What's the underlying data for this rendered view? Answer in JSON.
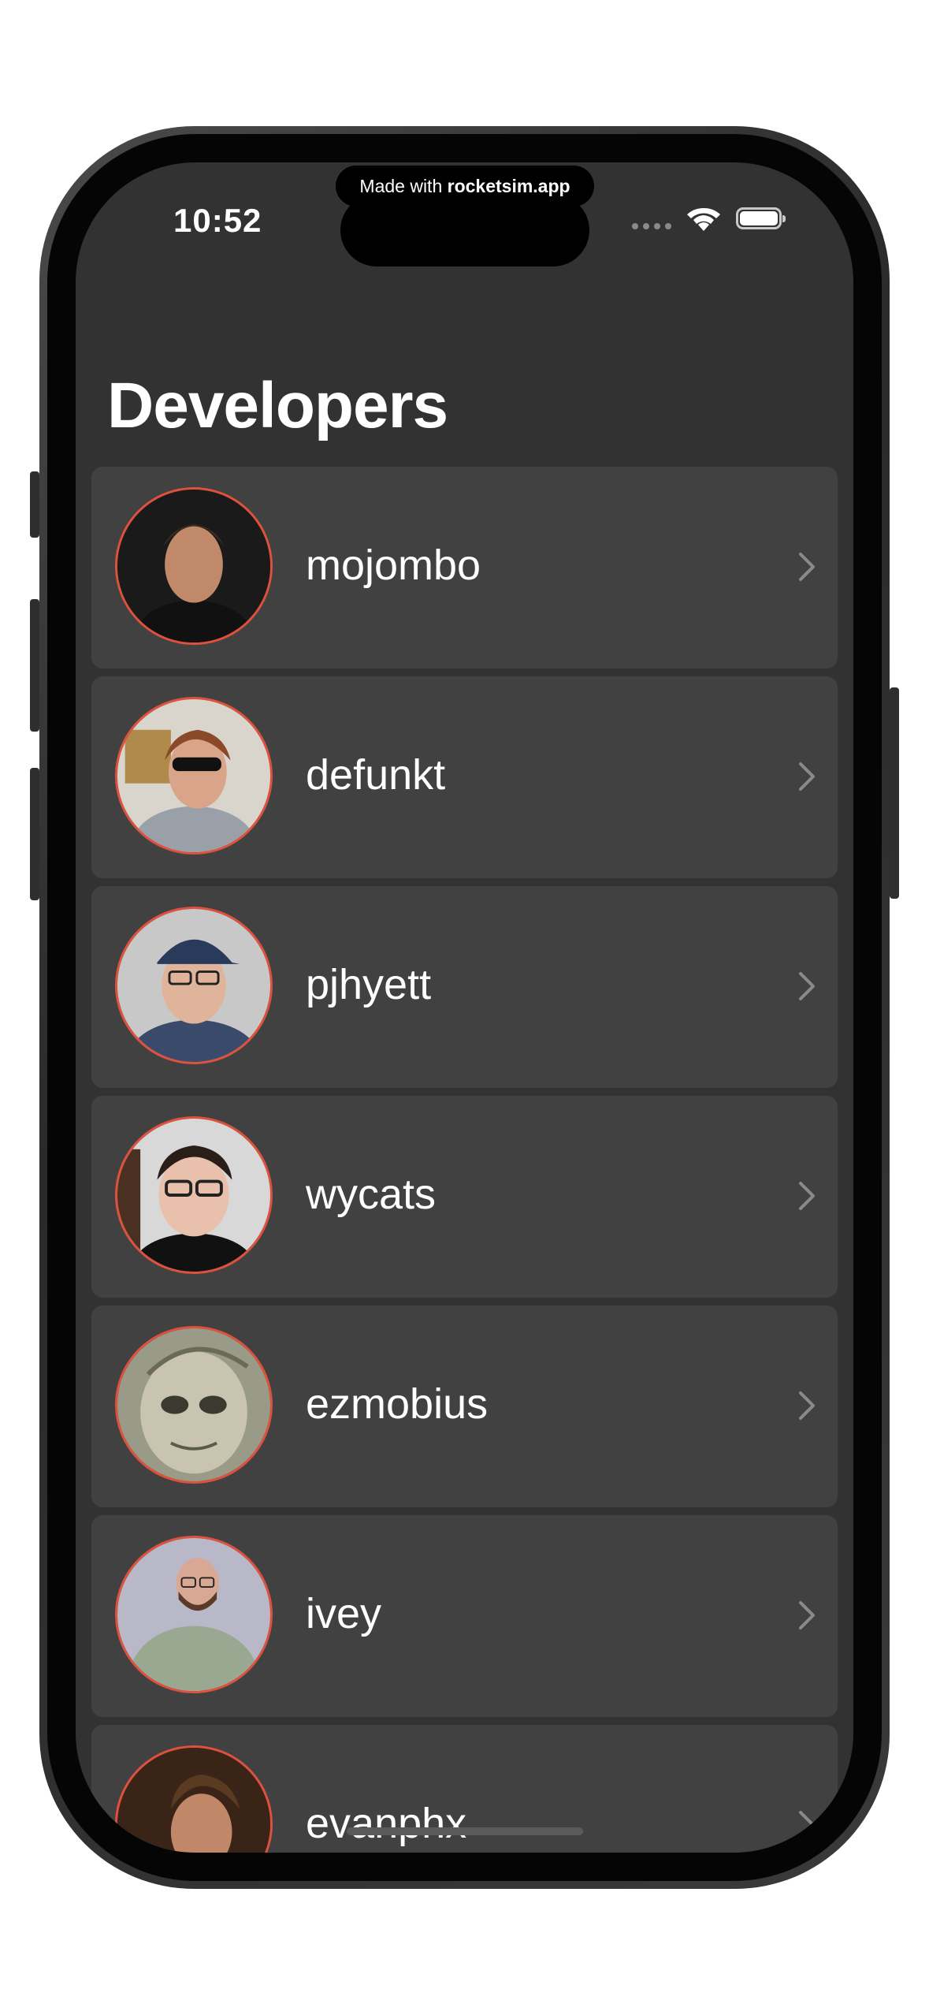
{
  "status_bar": {
    "time": "10:52",
    "made_with_prefix": "Made with ",
    "made_with_brand": "rocketsim.app"
  },
  "page": {
    "title": "Developers"
  },
  "developers": [
    {
      "username": "mojombo"
    },
    {
      "username": "defunkt"
    },
    {
      "username": "pjhyett"
    },
    {
      "username": "wycats"
    },
    {
      "username": "ezmobius"
    },
    {
      "username": "ivey"
    },
    {
      "username": "evanphx"
    }
  ],
  "colors": {
    "background": "#323232",
    "row_background": "#414141",
    "avatar_border": "#e0513d",
    "text": "#ffffff",
    "chevron": "#8a8a8a"
  },
  "icons": {
    "row_accessory": "chevron-right-icon",
    "wifi": "wifi-icon",
    "battery": "battery-icon",
    "cellular": "cellular-signal-icon"
  }
}
